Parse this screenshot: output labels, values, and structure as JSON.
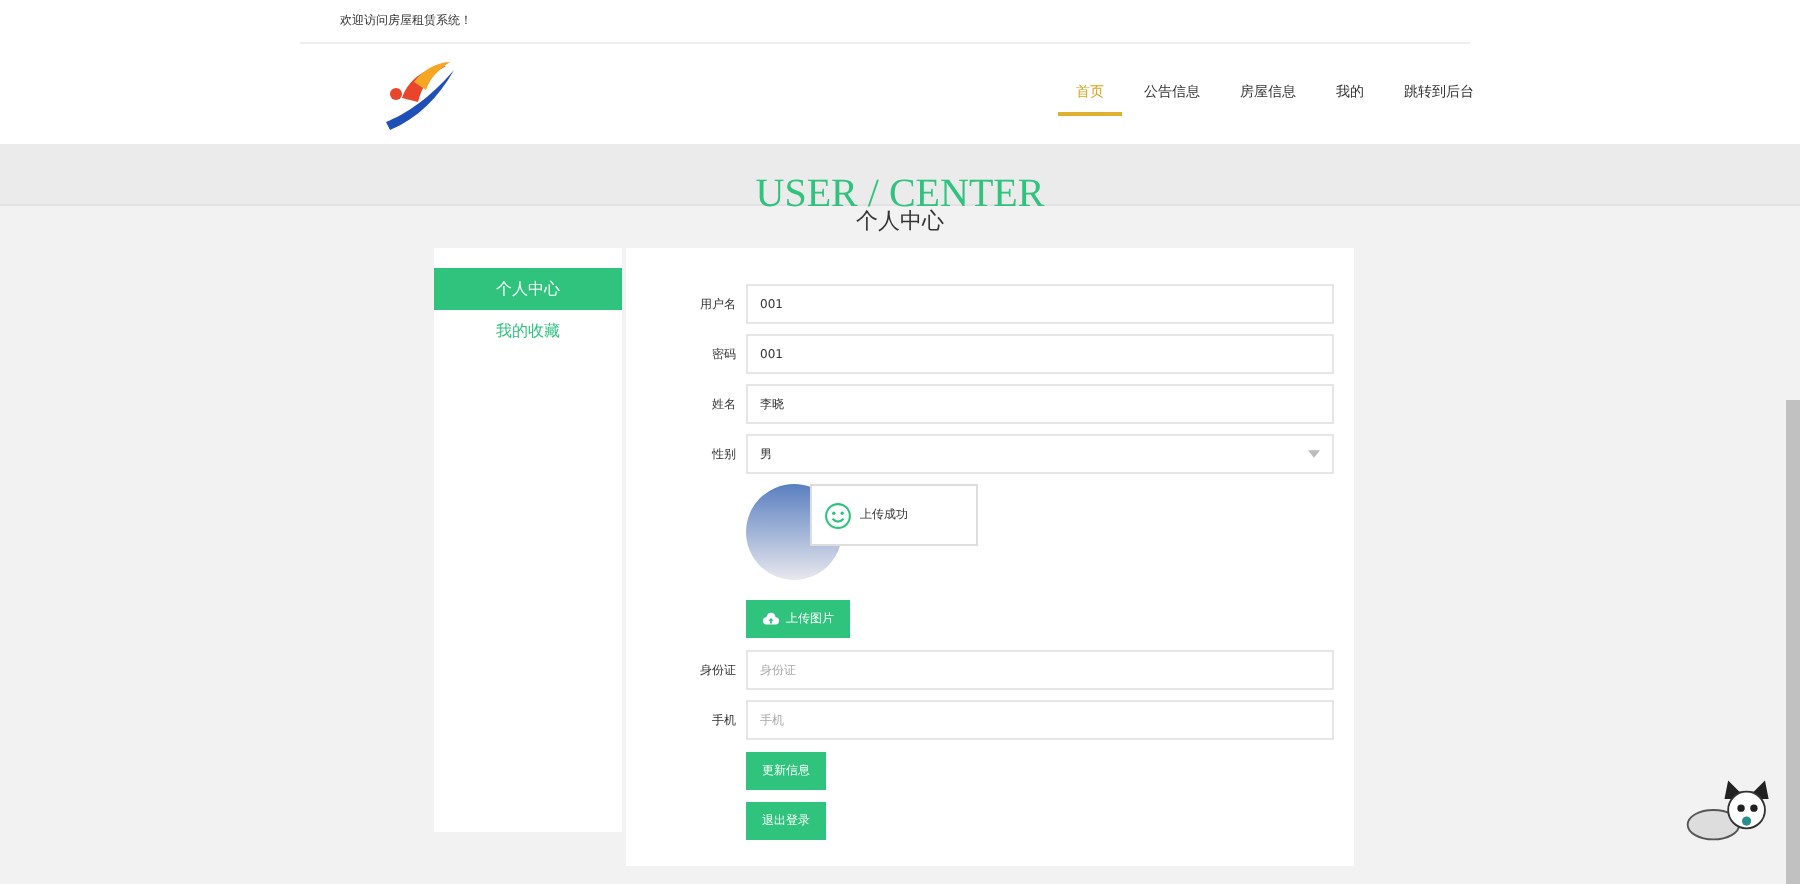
{
  "header": {
    "welcome": "欢迎访问房屋租赁系统！",
    "nav": [
      {
        "label": "首页",
        "selected": true
      },
      {
        "label": "公告信息",
        "selected": false
      },
      {
        "label": "房屋信息",
        "selected": false
      },
      {
        "label": "我的",
        "selected": false
      },
      {
        "label": "跳转到后台",
        "selected": false
      }
    ]
  },
  "banner": {
    "title": "USER / CENTER",
    "subtitle": "个人中心"
  },
  "sidebar": {
    "items": [
      {
        "label": "个人中心",
        "selected": true
      },
      {
        "label": "我的收藏",
        "selected": false
      }
    ]
  },
  "form": {
    "fields": [
      {
        "kind": "input",
        "label": "用户名",
        "value": "001"
      },
      {
        "kind": "input",
        "label": "密码",
        "value": "001"
      },
      {
        "kind": "input",
        "label": "姓名",
        "value": "李晓"
      },
      {
        "kind": "select",
        "label": "性别",
        "value": "男"
      },
      {
        "kind": "avatar",
        "toast": "上传成功",
        "button": "上传图片"
      },
      {
        "kind": "input",
        "label": "身份证",
        "placeholder": "身份证"
      },
      {
        "kind": "input",
        "label": "手机",
        "placeholder": "手机"
      }
    ],
    "buttons": [
      "更新信息",
      "退出登录"
    ]
  }
}
